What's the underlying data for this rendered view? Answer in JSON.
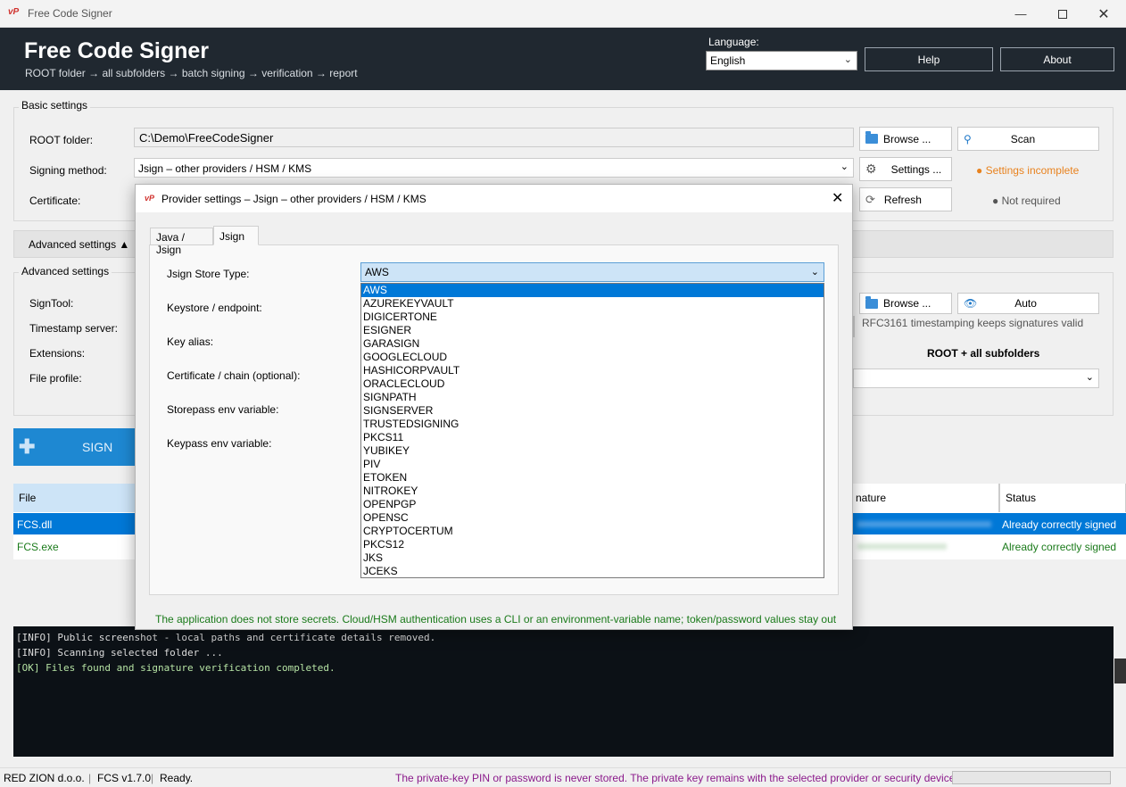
{
  "window": {
    "logo": "vP",
    "title": "Free Code Signer",
    "min_icon": "minimize-icon",
    "max_icon": "maximize-icon",
    "close_icon": "close-icon"
  },
  "header": {
    "title": "Free Code Signer",
    "subtitle": "ROOT folder → all subfolders → batch signing → verification → report",
    "language_label": "Language:",
    "language_value": "English",
    "help_label": "Help",
    "about_label": "About"
  },
  "basic": {
    "group_label": "Basic settings",
    "root_label": "ROOT folder:",
    "root_value": "C:\\Demo\\FreeCodeSigner",
    "method_label": "Signing method:",
    "method_value": "Jsign – other providers / HSM / KMS",
    "cert_label": "Certificate:",
    "browse_label": "Browse ...",
    "scan_label": "Scan",
    "settings_label": "Settings ...",
    "settings_status": "● Settings incomplete",
    "refresh_label": "Refresh",
    "refresh_status": "● Not required"
  },
  "advanced": {
    "toggle_label": "Advanced settings ▲",
    "group_label": "Advanced settings",
    "signtool_label": "SignTool:",
    "timestamp_label": "Timestamp server:",
    "extensions_label": "Extensions:",
    "profile_label": "File profile:",
    "browse_label": "Browse ...",
    "auto_label": "Auto",
    "rfc_note": "RFC3161 timestamping keeps signatures valid",
    "scope_label": "ROOT + all subfolders"
  },
  "sign_button": "SIGN",
  "table": {
    "headers": [
      "File",
      "nature",
      "Status"
    ],
    "rows": [
      {
        "file": "FCS.dll",
        "status": "Already correctly signed"
      },
      {
        "file": "FCS.exe",
        "status": "Already correctly signed"
      }
    ]
  },
  "console": [
    "[INFO] Public screenshot - local paths and certificate details removed.",
    "[INFO] Scanning selected folder ...",
    "[OK]   Files found and signature verification completed."
  ],
  "statusbar": {
    "company": "RED ZION d.o.o.",
    "version": "FCS v1.7.0",
    "state": "Ready.",
    "notice": "The private-key PIN or password is never stored. The private key remains with the selected provider or security device."
  },
  "dialog": {
    "logo": "vP",
    "title": "Provider settings – Jsign – other providers / HSM / KMS",
    "tabs": [
      "Java / Jsign",
      "Jsign"
    ],
    "store_type_label": "Jsign Store Type:",
    "store_type_value": "AWS",
    "keystore_label": "Keystore / endpoint:",
    "alias_label": "Key alias:",
    "chain_label": "Certificate / chain (optional):",
    "storepass_label": "Storepass env variable:",
    "keypass_label": "Keypass env variable:",
    "footer_note": "The application does not store secrets. Cloud/HSM authentication uses a CLI or an environment-variable name; token/password values stay out",
    "options": [
      "AWS",
      "AZUREKEYVAULT",
      "DIGICERTONE",
      "ESIGNER",
      "GARASIGN",
      "GOOGLECLOUD",
      "HASHICORPVAULT",
      "ORACLECLOUD",
      "SIGNPATH",
      "SIGNSERVER",
      "TRUSTEDSIGNING",
      "PKCS11",
      "YUBIKEY",
      "PIV",
      "ETOKEN",
      "NITROKEY",
      "OPENPGP",
      "OPENSC",
      "CRYPTOCERTUM",
      "PKCS12",
      "JKS",
      "JCEKS"
    ]
  },
  "colors": {
    "header_bg": "#202830",
    "accent_blue": "#0078d7",
    "sign_blue": "#1e88d2",
    "warn_orange": "#e8821e",
    "ok_green": "#1a7a1a",
    "notice_purple": "#8b1a8b"
  }
}
